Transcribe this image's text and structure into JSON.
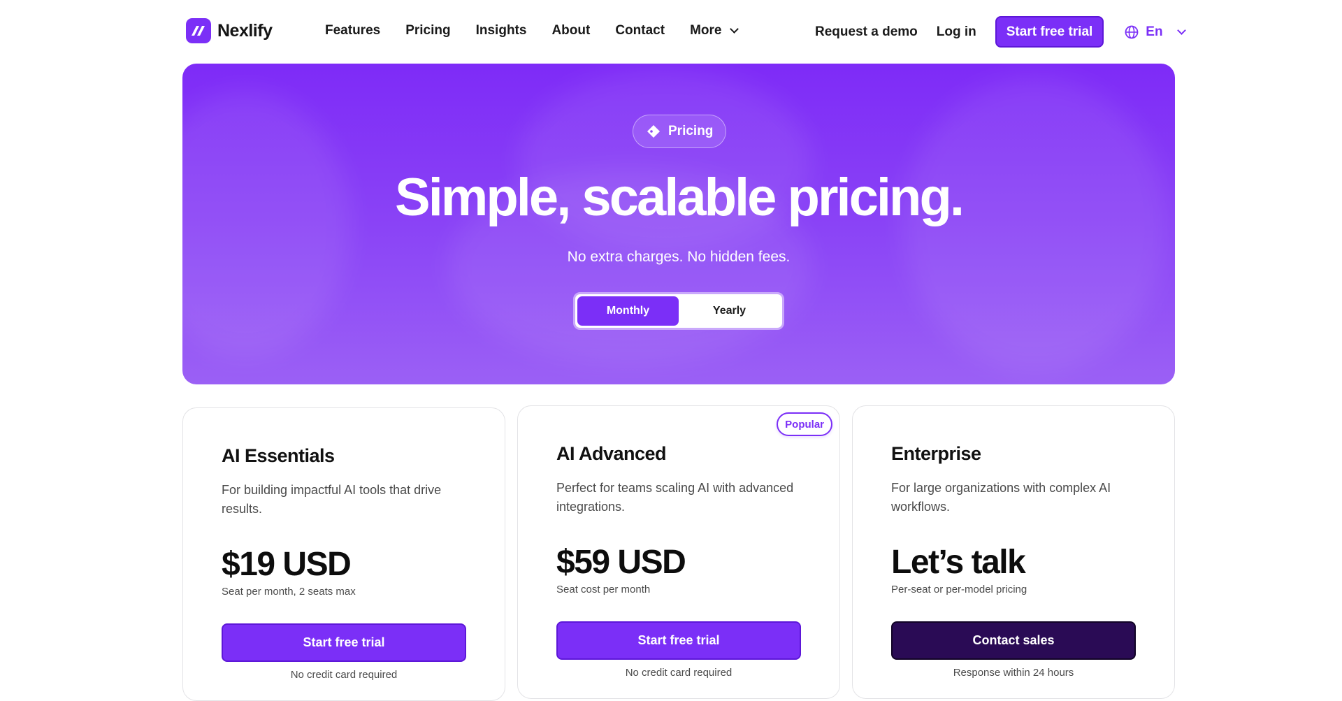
{
  "brand": {
    "name": "Nexlify",
    "accent": "#7b2ff7",
    "dark_cta": "#2a0b55"
  },
  "nav": {
    "links": [
      "Features",
      "Pricing",
      "Insights",
      "About",
      "Contact",
      "More"
    ],
    "request_demo": "Request a demo",
    "login": "Log in",
    "trial": "Start free trial",
    "language": "En"
  },
  "hero": {
    "badge": "Pricing",
    "title": "Simple, scalable pricing.",
    "subtitle": "No extra charges. No hidden fees.",
    "toggle": {
      "monthly": "Monthly",
      "yearly": "Yearly",
      "selected": "Monthly"
    }
  },
  "plans": [
    {
      "name": "AI Essentials",
      "description": "For building impactful AI tools that drive results.",
      "price": "$19 USD",
      "price_note": "Seat per month, 2 seats max",
      "cta": "Start free trial",
      "cta_note": "No credit card required"
    },
    {
      "name": "AI Advanced",
      "badge": "Popular",
      "description": "Perfect for teams scaling AI with advanced integrations.",
      "price": "$59 USD",
      "price_note": "Seat cost per month",
      "cta": "Start free trial",
      "cta_note": "No credit card required"
    },
    {
      "name": "Enterprise",
      "description": "For large organizations with complex AI workflows.",
      "price": "Let’s talk",
      "price_note": "Per-seat or per-model pricing",
      "cta": "Contact sales",
      "cta_note": "Response within 24 hours"
    }
  ]
}
